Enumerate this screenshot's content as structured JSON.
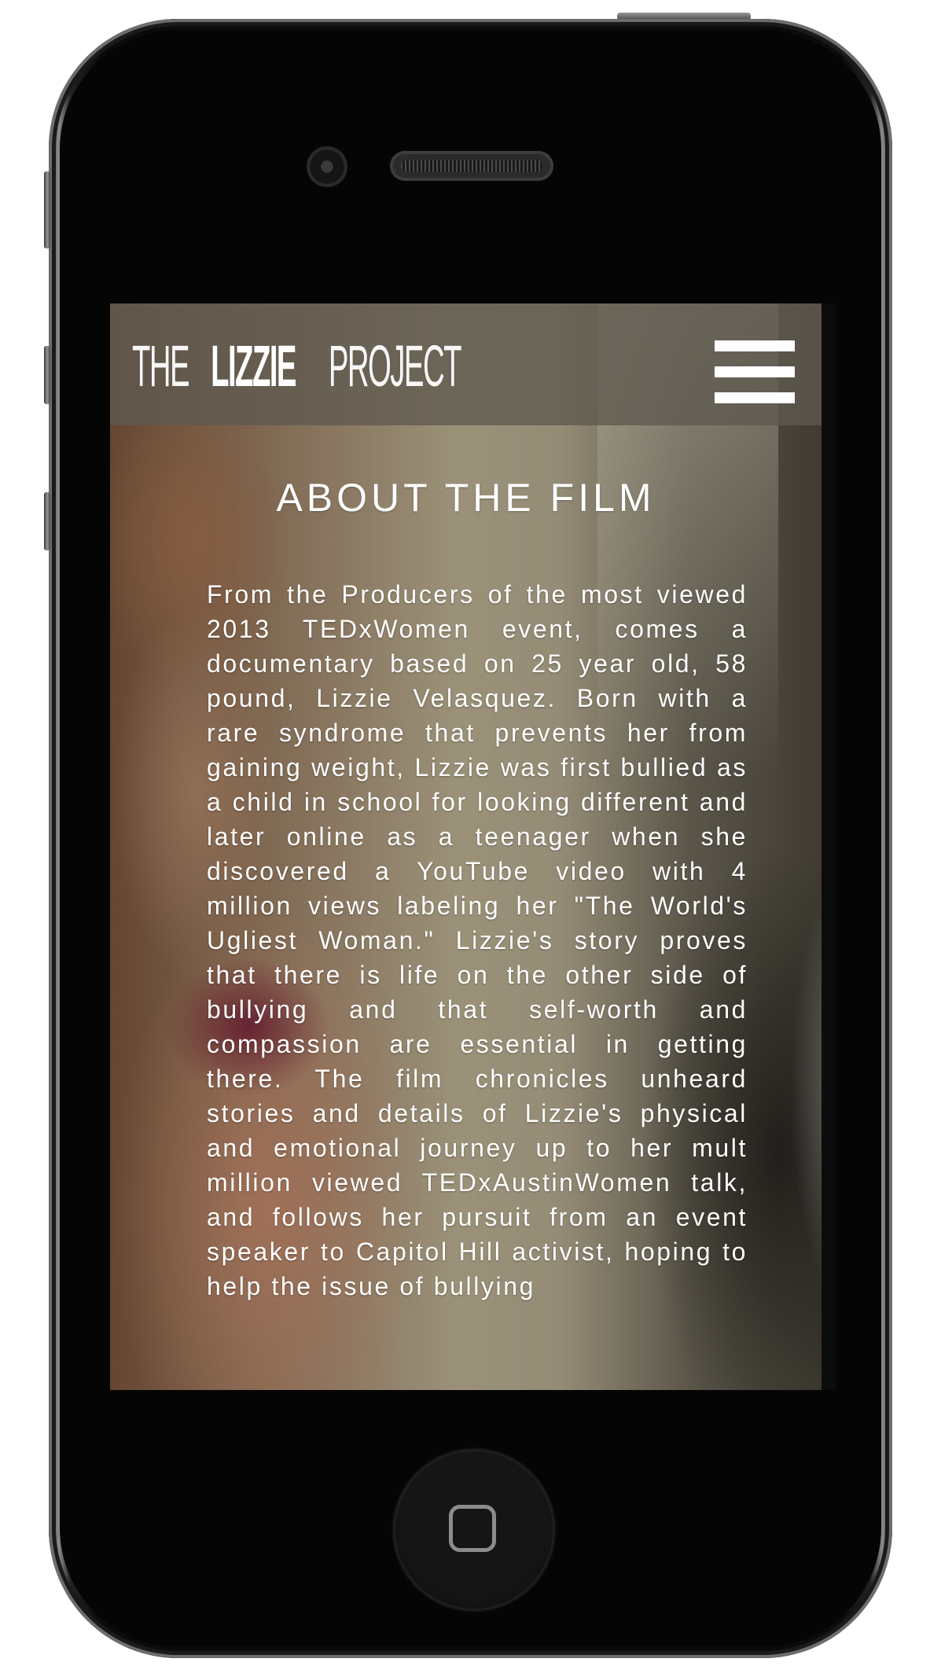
{
  "header": {
    "logo_the": "THE",
    "logo_lizzie": "LIZZIE",
    "logo_project": "PROJECT",
    "menu_icon": "hamburger-menu-icon"
  },
  "main": {
    "title": "ABOUT THE FILM",
    "body": "From the Producers of the most viewed 2013 TEDxWomen event, comes a documentary based on 25 year old, 58 pound, Lizzie Velasquez. Born with a rare syndrome that prevents her from gaining weight, Lizzie was first bullied as a child in school for looking different and later online as a teenager when she discovered a YouTube video with 4 million views labeling her \"The World's Ugliest Woman.\" Lizzie's story proves that there is life on the other side of bullying and that self-worth and compassion are essential in getting there. The film chronicles unheard stories and details of Lizzie's physical and emotional journey up to her mult million viewed TEDxAustinWomen talk, and follows her pursuit from an event speaker to Capitol Hill activist, hoping to help the issue of bullying"
  },
  "colors": {
    "header_overlay": "#5f5a50",
    "text": "#ffffff",
    "phone_body": "#0b0b0b"
  }
}
